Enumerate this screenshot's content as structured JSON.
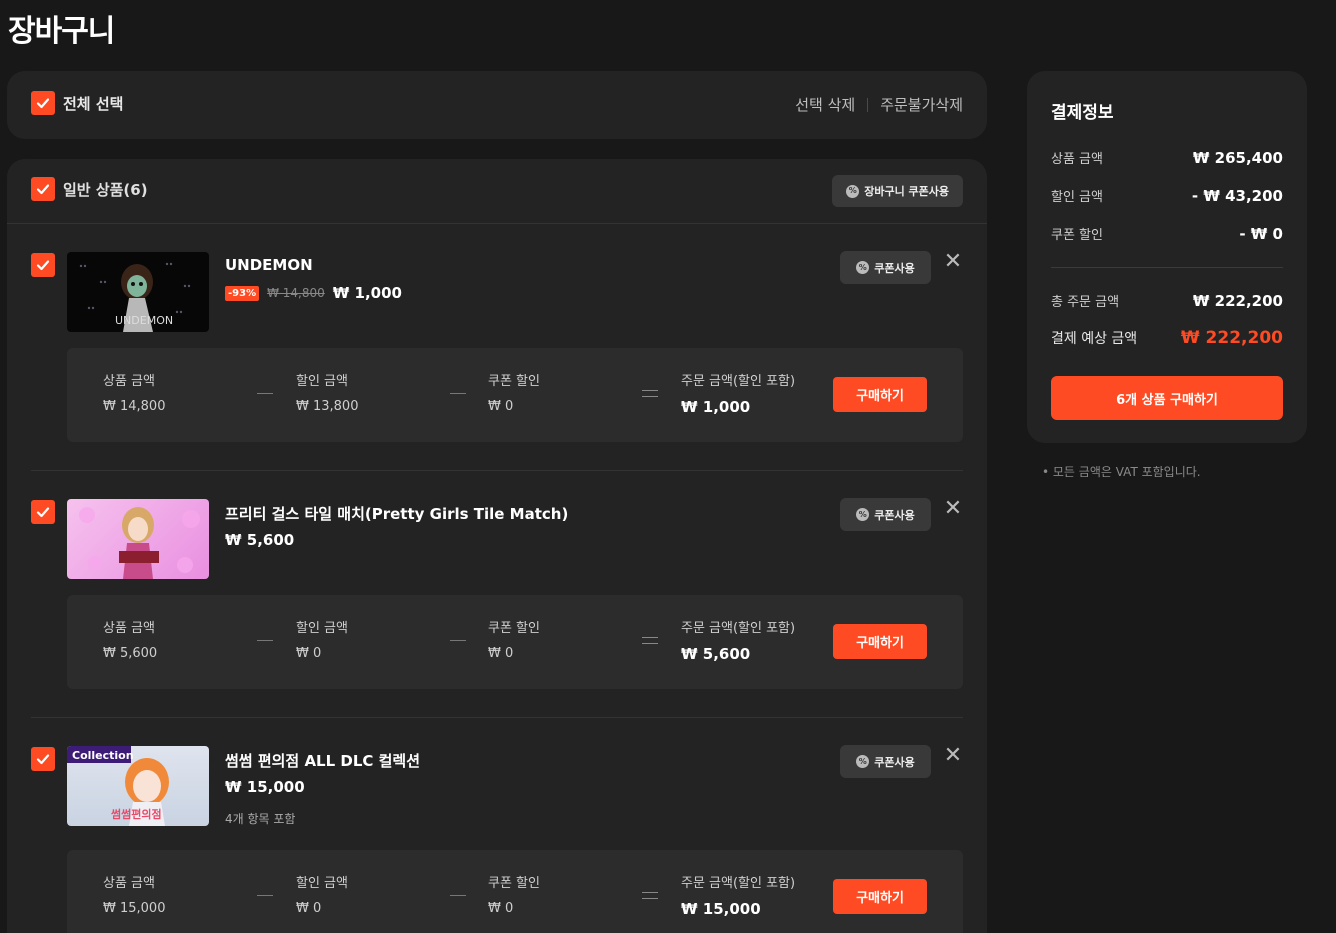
{
  "page": {
    "title": "장바구니"
  },
  "select_bar": {
    "select_all_label": "전체 선택",
    "delete_selected": "선택 삭제",
    "delete_unavailable": "주문불가삭제"
  },
  "list": {
    "header_label": "일반 상품(6)",
    "cart_coupon_label": "장바구니 쿠폰사용",
    "labels": {
      "coupon_use": "쿠폰사용",
      "product_amount": "상품 금액",
      "discount_amount": "할인 금액",
      "coupon_discount": "쿠폰 할인",
      "order_amount": "주문 금액(할인 포함)",
      "buy": "구매하기"
    },
    "items": [
      {
        "title": "UNDEMON",
        "discount_badge": "-93%",
        "original_price": "₩ 14,800",
        "price": "₩ 1,000",
        "product_amount": "₩ 14,800",
        "discount_amount": "₩ 13,800",
        "coupon_discount": "₩ 0",
        "order_amount": "₩ 1,000"
      },
      {
        "title": "프리티 걸스 타일 매치(Pretty Girls Tile Match)",
        "price": "₩ 5,600",
        "product_amount": "₩ 5,600",
        "discount_amount": "₩ 0",
        "coupon_discount": "₩ 0",
        "order_amount": "₩ 5,600"
      },
      {
        "title": "썸썸 편의점 ALL DLC 컬렉션",
        "price": "₩ 15,000",
        "note": "4개 항목 포함",
        "thumb_badge": "Collection",
        "thumb_text": "썸썸편의점",
        "product_amount": "₩ 15,000",
        "discount_amount": "₩ 0",
        "coupon_discount": "₩ 0",
        "order_amount": "₩ 15,000"
      }
    ]
  },
  "summary": {
    "title": "결제정보",
    "product_amount_label": "상품 금액",
    "product_amount": "₩ 265,400",
    "discount_label": "할인 금액",
    "discount": "- ₩ 43,200",
    "coupon_label": "쿠폰 할인",
    "coupon": "- ₩ 0",
    "total_label": "총 주문 금액",
    "total": "₩ 222,200",
    "expected_label": "결제 예상 금액",
    "expected": "₩ 222,200",
    "buy_label": "6개 상품 구매하기",
    "vat_note": "• 모든 금액은 VAT 포함입니다."
  },
  "colors": {
    "accent": "#ff4b23",
    "background": "#181818",
    "card": "#232323"
  },
  "icons": [
    "check-icon",
    "coupon-icon",
    "close-icon"
  ]
}
